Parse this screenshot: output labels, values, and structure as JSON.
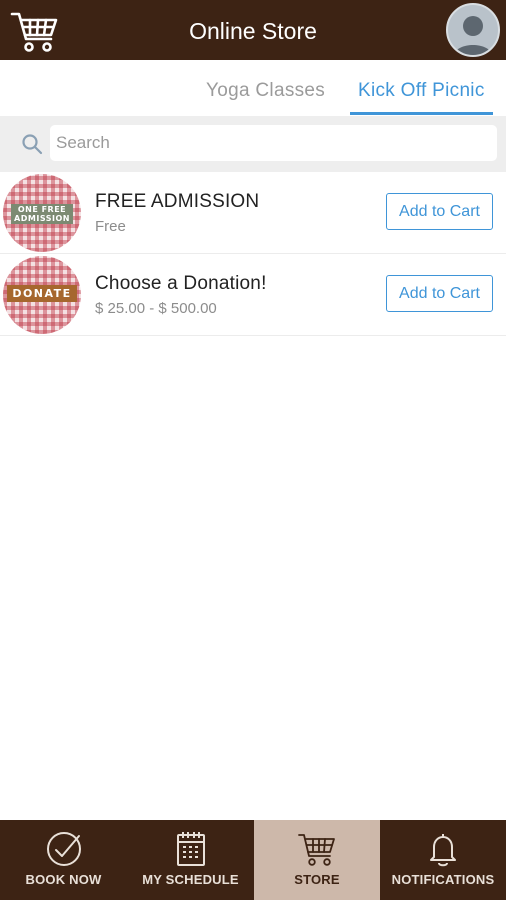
{
  "header": {
    "title": "Online Store",
    "cart_icon": "shopping-cart-icon",
    "avatar_icon": "user-avatar-icon"
  },
  "tabs": [
    {
      "label": "Yoga Classes",
      "active": false
    },
    {
      "label": "Kick Off Picnic",
      "active": true
    }
  ],
  "search": {
    "placeholder": "Search",
    "value": "",
    "icon": "search-icon"
  },
  "items": [
    {
      "name": "FREE ADMISSION",
      "price": "Free",
      "thumb_text": "ONE FREE ADMISSION",
      "button_label": "Add to Cart"
    },
    {
      "name": "Choose a Donation!",
      "price": "$ 25.00 - $ 500.00",
      "thumb_text": "DONATE",
      "button_label": "Add to Cart"
    }
  ],
  "bottom_nav": [
    {
      "label": "BOOK NOW",
      "icon": "checkmark-circle-icon",
      "active": false
    },
    {
      "label": "MY SCHEDULE",
      "icon": "calendar-icon",
      "active": false
    },
    {
      "label": "STORE",
      "icon": "shopping-cart-icon",
      "active": true
    },
    {
      "label": "NOTIFICATIONS",
      "icon": "bell-icon",
      "active": false
    }
  ],
  "colors": {
    "brand_brown": "#3d2314",
    "accent_blue": "#3f95d8",
    "active_nav_bg": "#cdb8aa"
  }
}
